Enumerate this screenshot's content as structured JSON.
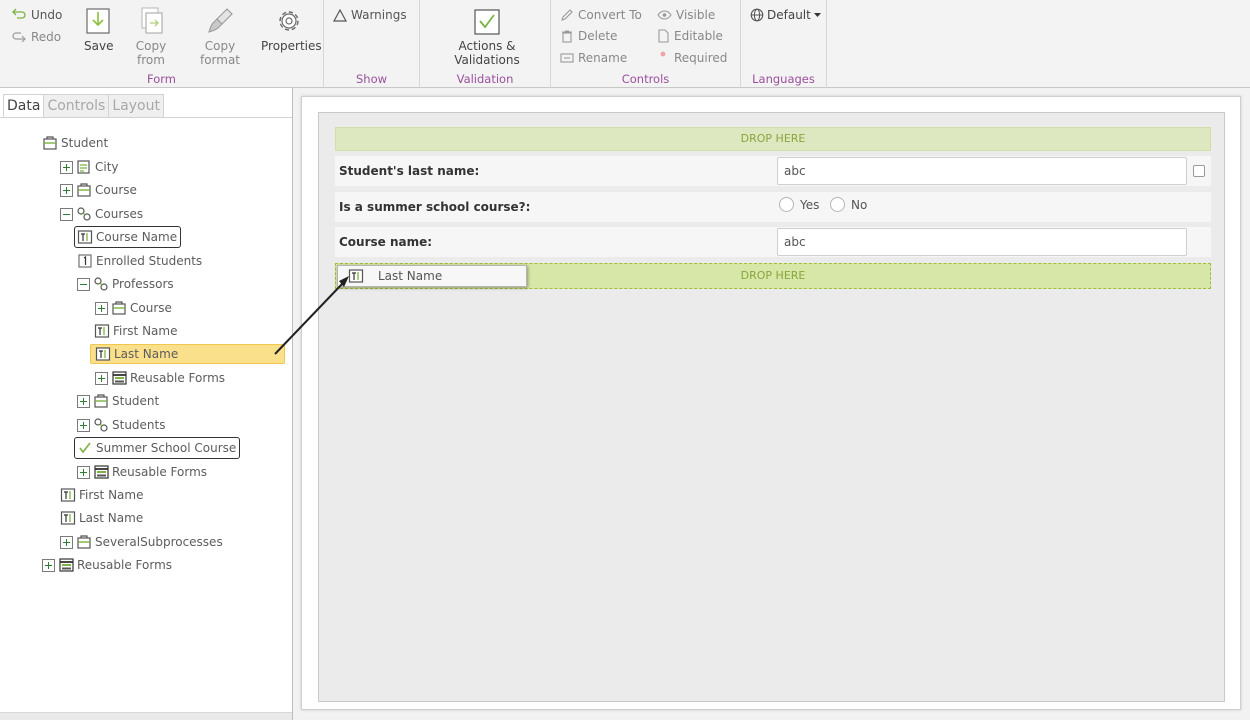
{
  "ribbon": {
    "form": {
      "undo": "Undo",
      "redo": "Redo",
      "save": "Save",
      "copy_from": "Copy from",
      "copy_format": "Copy format",
      "properties": "Properties",
      "label": "Form"
    },
    "show": {
      "warnings": "Warnings",
      "label": "Show"
    },
    "validation": {
      "actions": "Actions & Validations",
      "label": "Validation"
    },
    "controls": {
      "convert_to": "Convert To",
      "delete": "Delete",
      "rename": "Rename",
      "visible": "Visible",
      "editable": "Editable",
      "required": "Required",
      "label": "Controls"
    },
    "languages": {
      "default": "Default",
      "label": "Languages"
    },
    "accent_color": "#9a4f9c"
  },
  "left_panel": {
    "tabs": [
      "Data",
      "Controls",
      "Layout"
    ],
    "active_tab": "Data",
    "tree": [
      {
        "label": "Student",
        "icon": "entity-icon"
      },
      {
        "label": "City",
        "icon": "entity-list-icon"
      },
      {
        "label": "Course",
        "icon": "entity-icon"
      },
      {
        "label": "Courses",
        "icon": "collection-icon"
      },
      {
        "label": "Course Name",
        "icon": "text-field-icon"
      },
      {
        "label": "Enrolled Students",
        "icon": "number-field-icon"
      },
      {
        "label": "Professors",
        "icon": "collection-icon"
      },
      {
        "label": "Course",
        "icon": "entity-icon"
      },
      {
        "label": "First Name",
        "icon": "text-field-icon"
      },
      {
        "label": "Last Name",
        "icon": "text-field-icon"
      },
      {
        "label": "Reusable Forms",
        "icon": "form-icon"
      },
      {
        "label": "Student",
        "icon": "entity-icon"
      },
      {
        "label": "Students",
        "icon": "collection-icon"
      },
      {
        "label": "Summer School Course",
        "icon": "checkmark-icon"
      },
      {
        "label": "Reusable Forms",
        "icon": "form-icon"
      },
      {
        "label": "First Name",
        "icon": "text-field-icon"
      },
      {
        "label": "Last Name",
        "icon": "text-field-icon"
      },
      {
        "label": "SeveralSubprocesses",
        "icon": "entity-icon"
      },
      {
        "label": "Reusable Forms",
        "icon": "form-icon"
      }
    ]
  },
  "form_canvas": {
    "drop_here": "DROP HERE",
    "fields": [
      {
        "label": "Student's last name:",
        "value": "abc"
      },
      {
        "label": "Is a summer school course?:",
        "options": [
          "Yes",
          "No"
        ]
      },
      {
        "label": "Course name:",
        "value": "abc"
      }
    ],
    "drag_chip": "Last Name"
  }
}
